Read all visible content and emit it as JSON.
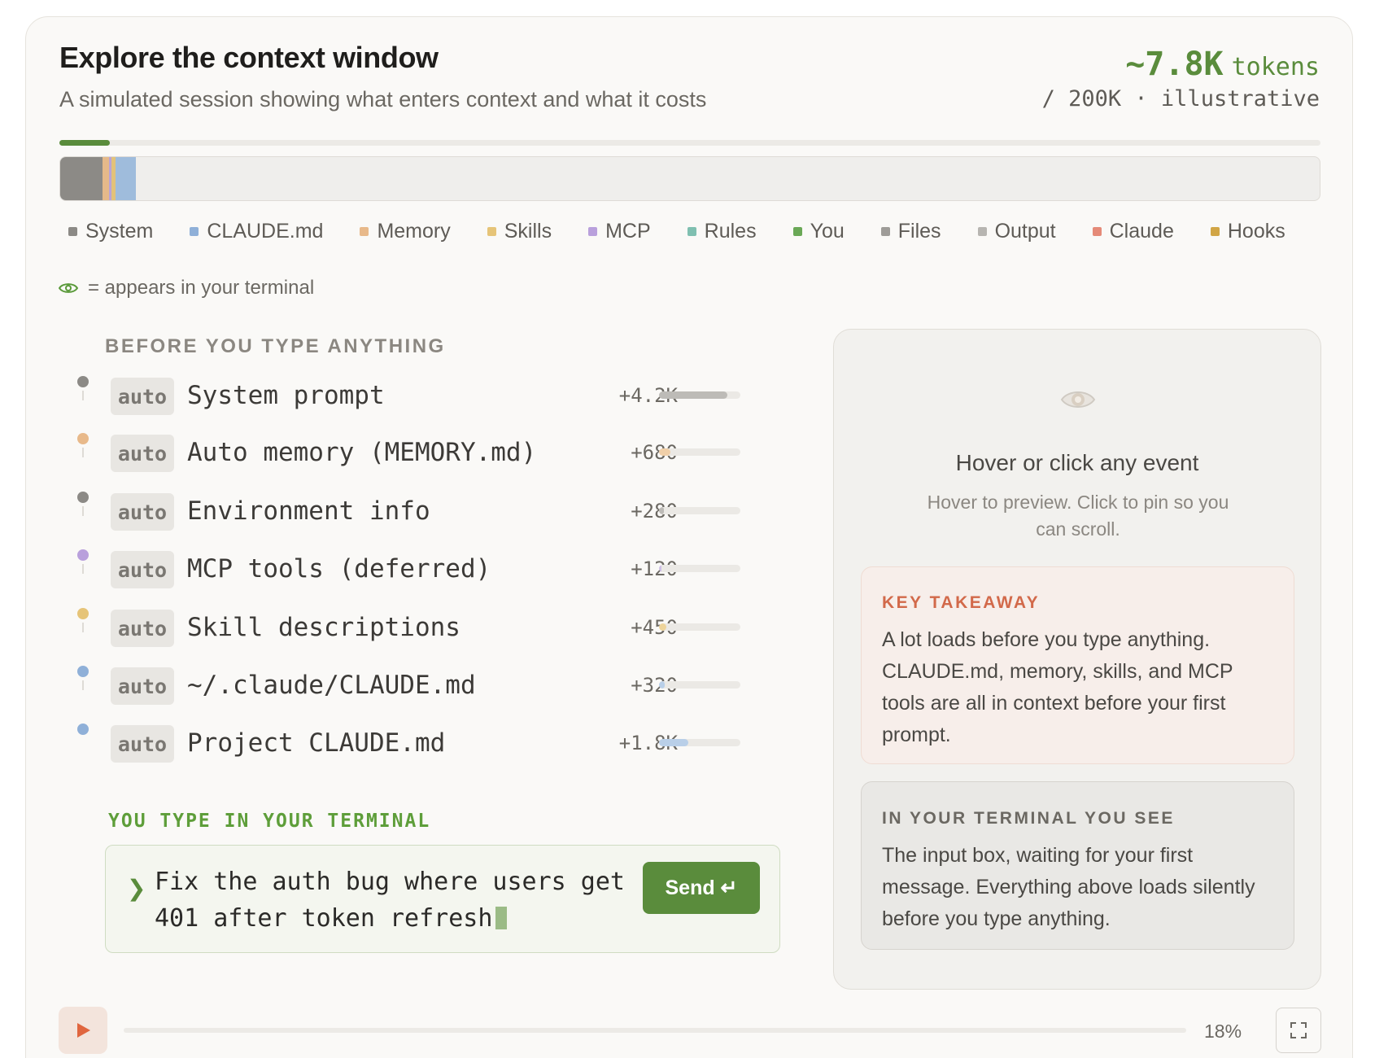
{
  "header": {
    "title": "Explore the context window",
    "subtitle": "A simulated session showing what enters context and what it costs",
    "token_count": "~7.8K",
    "token_unit": "tokens",
    "token_limit": "/ 200K · illustrative"
  },
  "progress": {
    "fraction": 0.04
  },
  "context_bar": {
    "segments": [
      {
        "category": "System",
        "tokens": 4480,
        "color": "#8c8a86"
      },
      {
        "category": "Memory",
        "tokens": 680,
        "color": "#e5b98a"
      },
      {
        "category": "MCP",
        "tokens": 120,
        "color": "#b9a4d6"
      },
      {
        "category": "Skills",
        "tokens": 450,
        "color": "#e2c27a"
      },
      {
        "category": "CLAUDE.md",
        "tokens": 2120,
        "color": "#9fbcdc"
      }
    ],
    "capacity": 200000
  },
  "legend": [
    {
      "label": "System",
      "color": "#8c8a86"
    },
    {
      "label": "CLAUDE.md",
      "color": "#8fb0d8"
    },
    {
      "label": "Memory",
      "color": "#e8b98a"
    },
    {
      "label": "Skills",
      "color": "#e6c478"
    },
    {
      "label": "MCP",
      "color": "#b9a0dc"
    },
    {
      "label": "Rules",
      "color": "#7fbfb0"
    },
    {
      "label": "You",
      "color": "#6aa856"
    },
    {
      "label": "Files",
      "color": "#9e9c98"
    },
    {
      "label": "Output",
      "color": "#b7b5b1"
    },
    {
      "label": "Claude",
      "color": "#e58a78"
    },
    {
      "label": "Hooks",
      "color": "#d1a545"
    }
  ],
  "eye_note": "= appears in your terminal",
  "section_before": "BEFORE YOU TYPE ANYTHING",
  "events": [
    {
      "tag": "auto",
      "name": "System prompt",
      "value": "+4.2K",
      "fraction": 0.84,
      "color": "#bdbbb7",
      "dot": "#8c8a86"
    },
    {
      "tag": "auto",
      "name": "Auto memory (MEMORY.md)",
      "value": "+680",
      "fraction": 0.14,
      "color": "#f0cfa8",
      "dot": "#e8b98a"
    },
    {
      "tag": "auto",
      "name": "Environment info",
      "value": "+280",
      "fraction": 0.06,
      "color": "#bdbbb7",
      "dot": "#8c8a86"
    },
    {
      "tag": "auto",
      "name": "MCP tools (deferred)",
      "value": "+120",
      "fraction": 0.03,
      "color": "#cfc0e6",
      "dot": "#b9a0dc"
    },
    {
      "tag": "auto",
      "name": "Skill descriptions",
      "value": "+450",
      "fraction": 0.09,
      "color": "#eed49a",
      "dot": "#e6c478"
    },
    {
      "tag": "auto",
      "name": "~/.claude/CLAUDE.md",
      "value": "+320",
      "fraction": 0.065,
      "color": "#b9cfe8",
      "dot": "#8fb0d8"
    },
    {
      "tag": "auto",
      "name": "Project CLAUDE.md",
      "value": "+1.8K",
      "fraction": 0.36,
      "color": "#b9cfe8",
      "dot": "#8fb0d8"
    }
  ],
  "you_type": {
    "label": "YOU TYPE IN YOUR TERMINAL",
    "prompt_symbol": "❯",
    "message": "Fix the auth bug where users get 401 after token refresh",
    "send_label": "Send ↵"
  },
  "detail_panel": {
    "title": "Hover or click any event",
    "hint": "Hover to preview. Click to pin so you can scroll.",
    "takeaway_label": "KEY TAKEAWAY",
    "takeaway_text": "A lot loads before you type anything. CLAUDE.md, memory, skills, and MCP tools are all in context before your first prompt.",
    "terminal_label": "IN YOUR TERMINAL YOU SEE",
    "terminal_text": "The input box, waiting for your first message. Everything above loads silently before you type anything."
  },
  "playback": {
    "percent": "18%",
    "fraction": 0.18
  },
  "colors": {
    "accent": "#5a8c3c",
    "takeaway": "#d2694a",
    "play": "#e0663f"
  }
}
